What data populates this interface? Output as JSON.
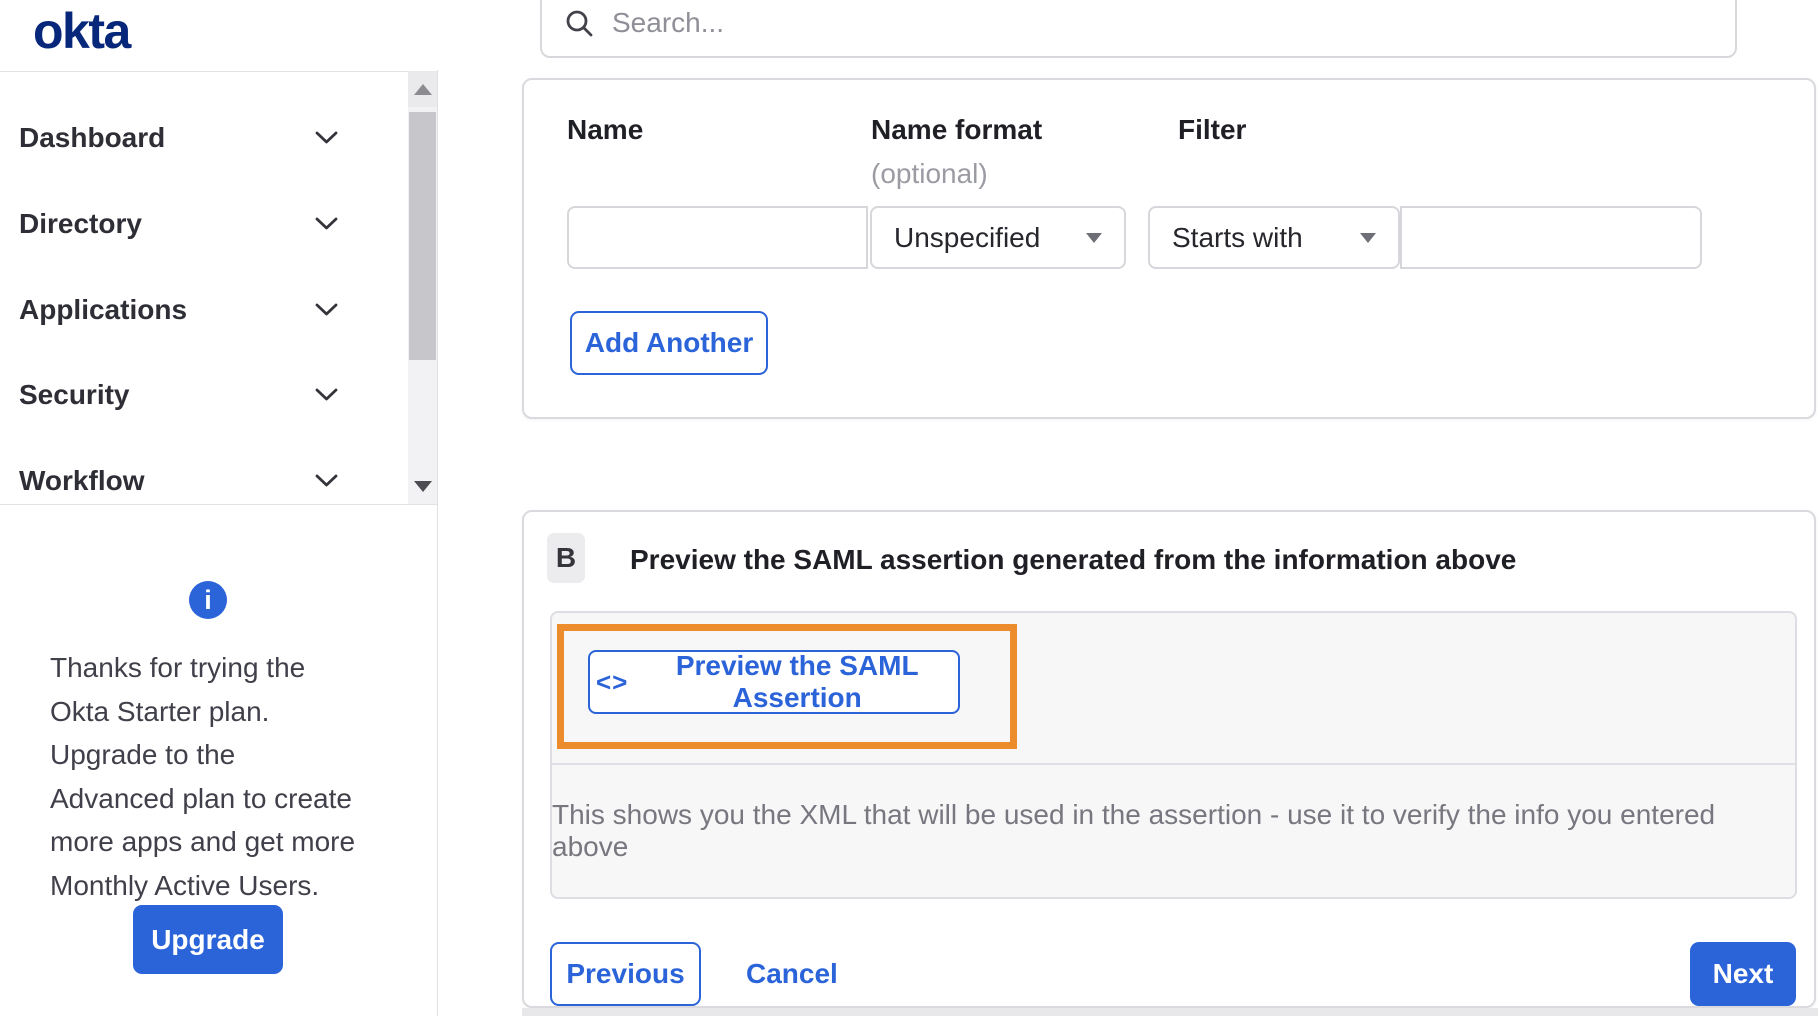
{
  "header": {
    "logo_text": "okta",
    "search_placeholder": "Search..."
  },
  "sidebar": {
    "items": [
      {
        "label": "Dashboard"
      },
      {
        "label": "Directory"
      },
      {
        "label": "Applications"
      },
      {
        "label": "Security"
      },
      {
        "label": "Workflow"
      }
    ],
    "plan_note": "Thanks for trying the Okta Starter plan. Upgrade to the Advanced plan to create more apps and get more Monthly Active Users.",
    "upgrade_label": "Upgrade"
  },
  "attribute_form": {
    "name_label": "Name",
    "name_format_label": "Name format",
    "name_format_hint": "(optional)",
    "filter_label": "Filter",
    "name_value": "",
    "name_format_value": "Unspecified",
    "filter_type_value": "Starts with",
    "filter_value": "",
    "add_another_label": "Add Another"
  },
  "preview_section": {
    "step_badge": "B",
    "title": "Preview the SAML assertion generated from the information above",
    "code_icon": "<>",
    "preview_button_label": "Preview the SAML Assertion",
    "description": "This shows you the XML that will be used in the assertion - use it to verify the info you entered above"
  },
  "footer": {
    "previous_label": "Previous",
    "cancel_label": "Cancel",
    "next_label": "Next"
  },
  "colors": {
    "accent_blue": "#2b63d9",
    "brand_navy": "#07277a",
    "highlight_orange": "#ec8c2c"
  }
}
